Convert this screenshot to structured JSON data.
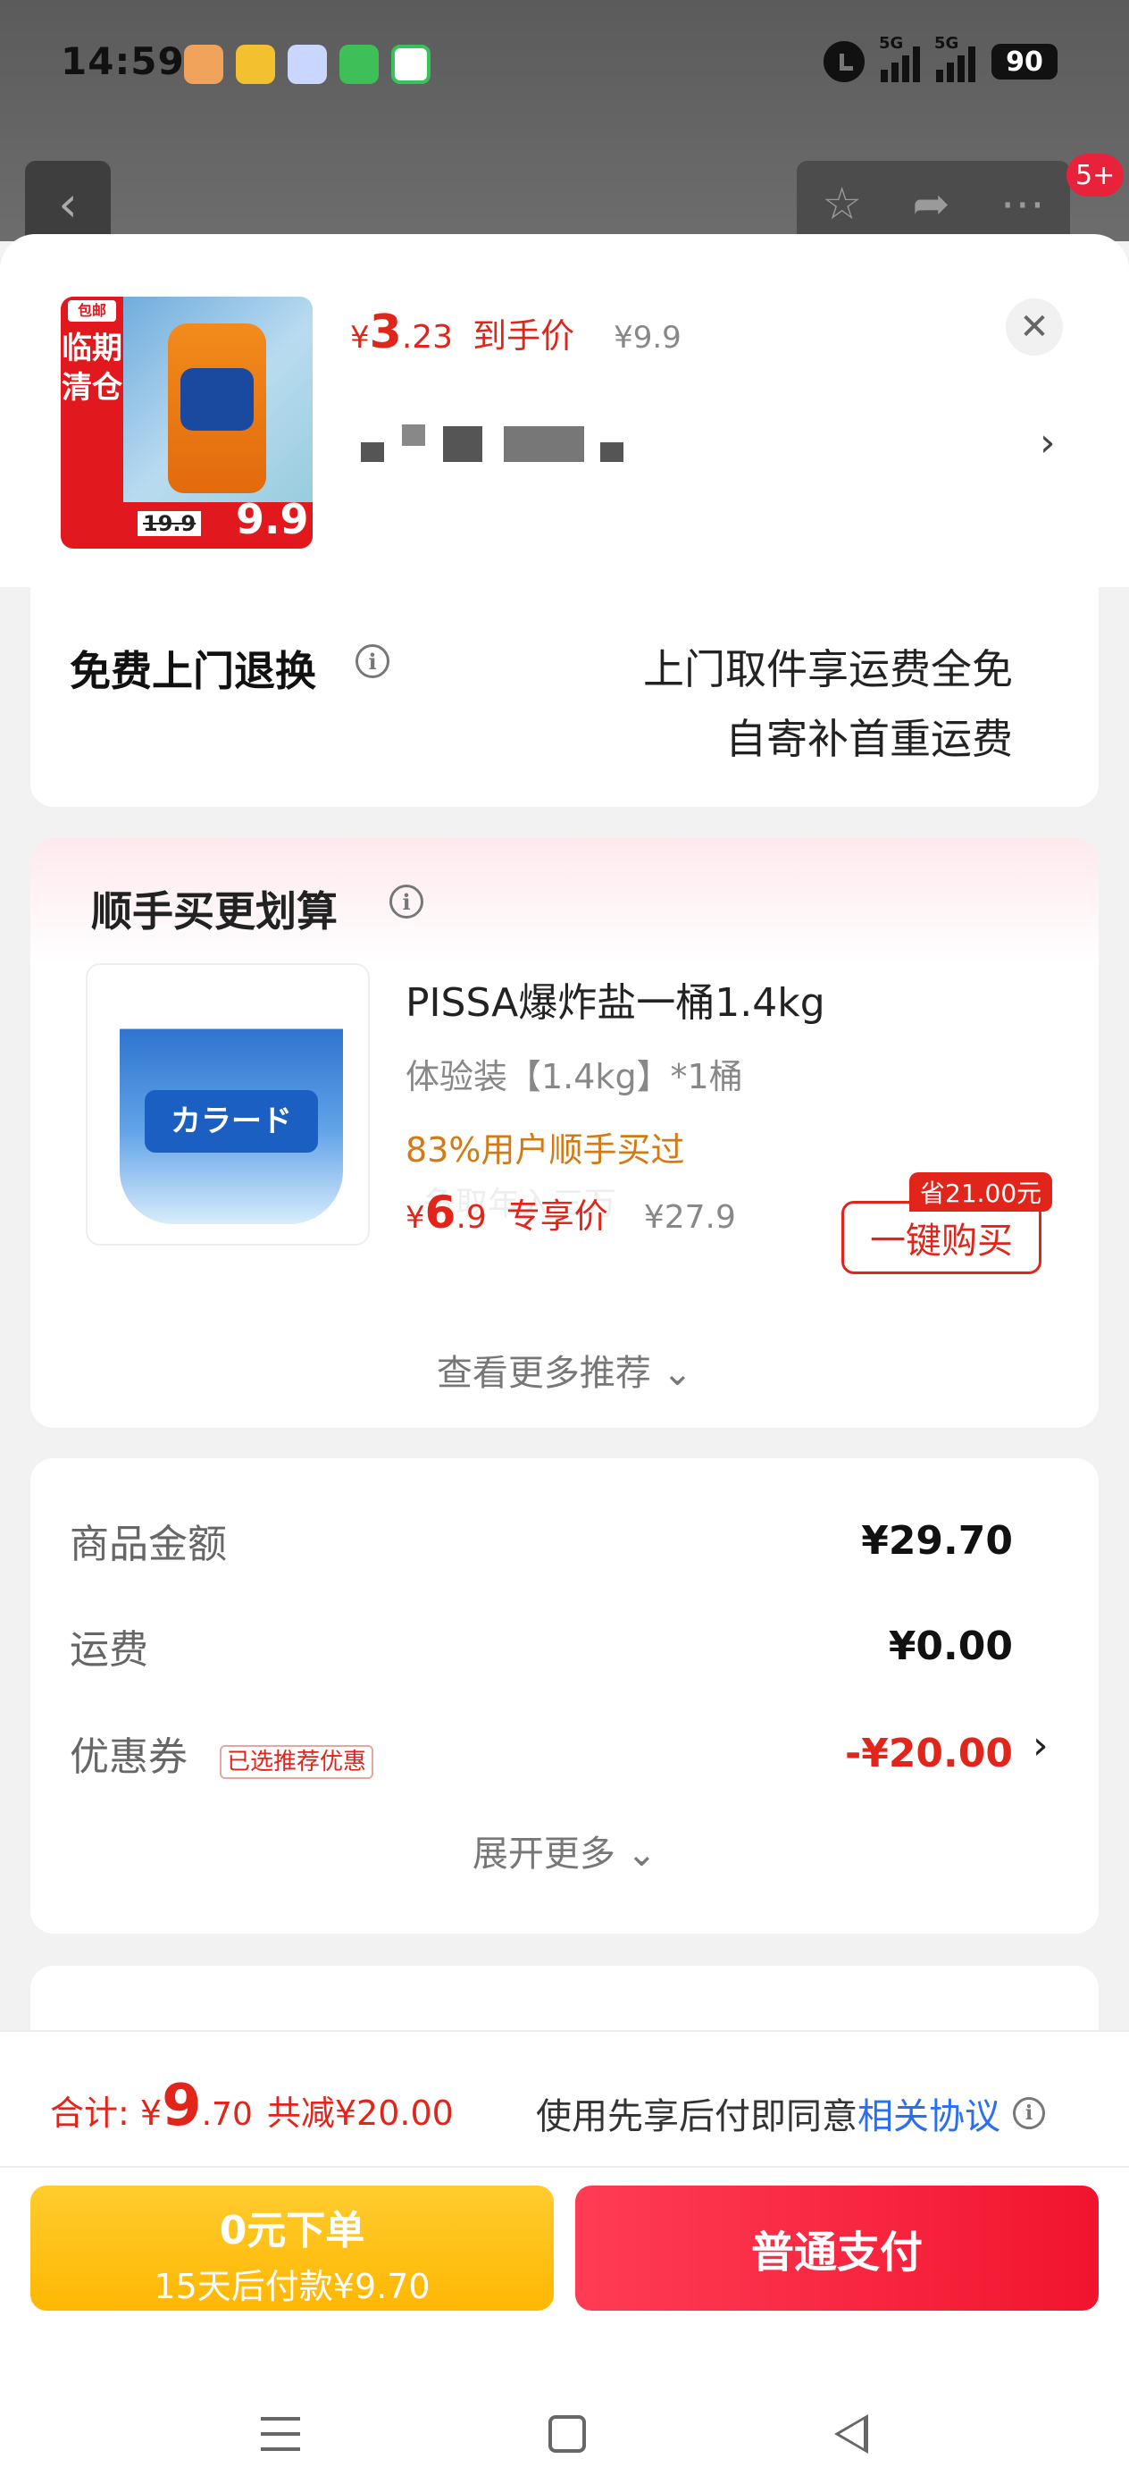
{
  "status_bar": {
    "time": "14:59",
    "signal_label_1": "5G",
    "signal_label_2": "5G",
    "battery": "90"
  },
  "top_nav": {
    "back_icon": "chevron-left-icon",
    "badge_count": "5+"
  },
  "product": {
    "price_currency": "¥",
    "price_int": "3",
    "price_dec": ".23",
    "price_label": "到手价",
    "original_price": "¥9.9",
    "thumb_side_text": "临期清仓",
    "thumb_side_tag": "包邮",
    "thumb_old_price": "19.9",
    "thumb_new_price": "9.9"
  },
  "returns": {
    "title": "免费上门退换",
    "line1": "上门取件享运费全免",
    "line2": "自寄补首重运费"
  },
  "recommend": {
    "title": "顺手买更划算",
    "item_name": "PISSA爆炸盐一桶1.4kg",
    "item_spec": "体验装【1.4kg】*1桶",
    "buy_rate": "83%用户顺手买过",
    "ghost_text": "争取年入三万",
    "price_currency": "¥",
    "price_int": "6",
    "price_dec": ".9",
    "price_label": "专享价",
    "original_price": "¥27.9",
    "save_tag": "省21.00元",
    "buy_button": "一键购买",
    "more": "查看更多推荐 ⌄",
    "tub_label": "カラード"
  },
  "summary": {
    "goods_label": "商品金额",
    "goods_value": "¥29.70",
    "shipping_label": "运费",
    "shipping_value": "¥0.00",
    "coupon_label": "优惠券",
    "coupon_tag": "已选推荐优惠",
    "coupon_value": "-¥20.00",
    "expand": "展开更多 ⌄"
  },
  "checkout": {
    "total_label": "合计: ¥",
    "total_int": "9",
    "total_dec": ".70",
    "total_reduce": "共减¥20.00",
    "agree_text": "使用先享后付即同意",
    "agree_link": "相关协议",
    "zero_line1": "0元下单",
    "zero_line2": "15天后付款¥9.70",
    "pay_button": "普通支付"
  },
  "colors": {
    "accent_red": "#e1251b",
    "pay_gradient_start": "#ff3c55",
    "zero_button_yellow": "#ffb703",
    "link_blue": "#2a6ff0",
    "buy_rate_orange": "#d27a13"
  }
}
